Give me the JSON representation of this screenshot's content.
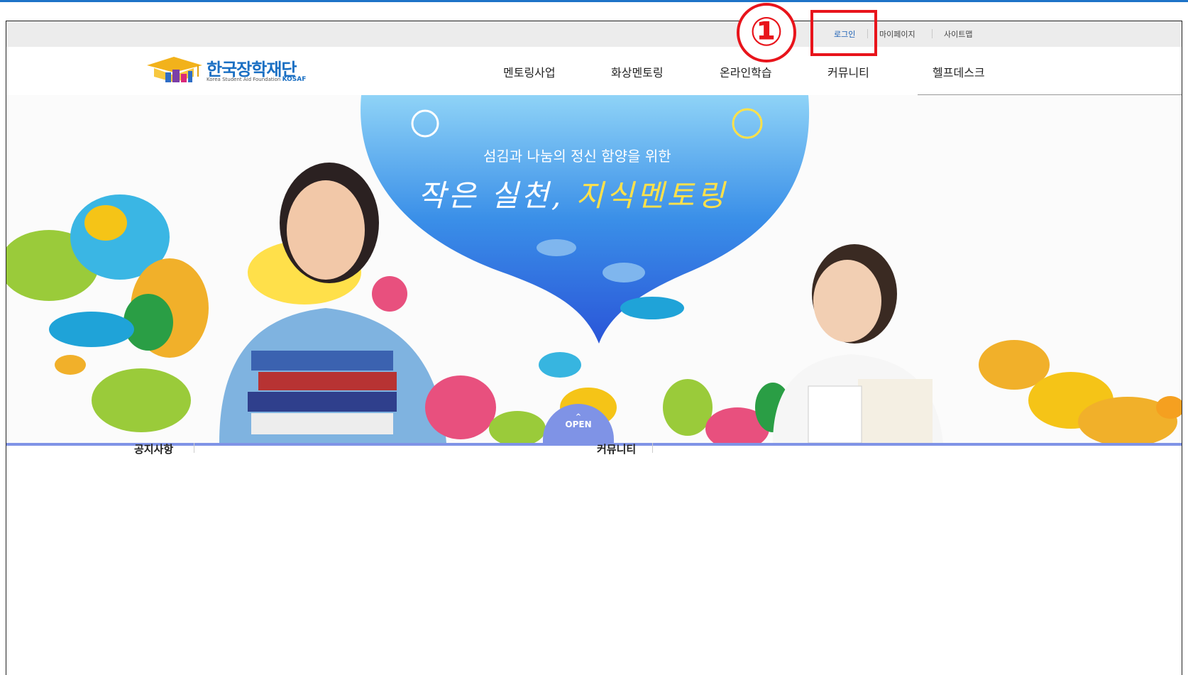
{
  "util_nav": {
    "login": "로그인",
    "mypage": "마이페이지",
    "sitemap": "사이트맵"
  },
  "logo": {
    "title": "한국장학재단",
    "subtitle": "Korea Student Aid Foundation",
    "abbr": "KOSAF"
  },
  "gnb": [
    "멘토링사업",
    "화상멘토링",
    "온라인학습",
    "커뮤니티",
    "헬프데스크"
  ],
  "hero": {
    "subtitle": "섬김과 나눔의 정신 함양을 위한",
    "title_part1": "작은 실천,",
    "title_part2": "지식멘토링",
    "open_label": "OPEN"
  },
  "boards": {
    "notice": "공지사항",
    "community": "커뮤니티"
  },
  "annotation": {
    "marker": "①",
    "color": "#e8141b"
  },
  "colors": {
    "brand_blue": "#1a6fc3",
    "accent_line": "#7f93e6"
  }
}
